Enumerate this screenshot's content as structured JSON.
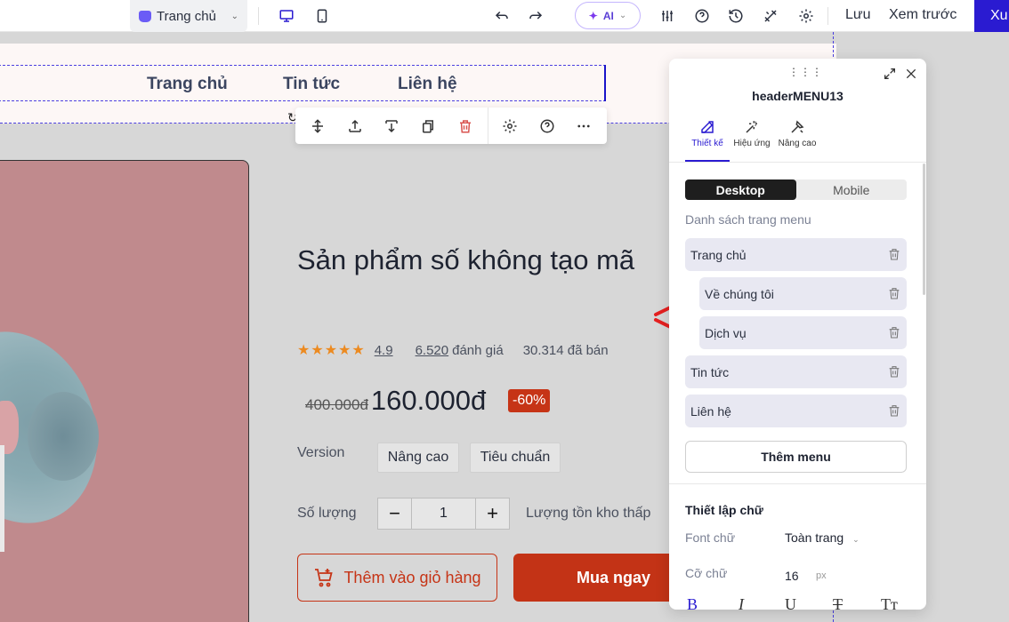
{
  "topbar": {
    "page_selector": "Trang chủ",
    "ai_label": "AI",
    "save_label": "Lưu",
    "preview_label": "Xem trước",
    "publish_label": "Xu"
  },
  "header_menu": {
    "links": [
      "Trang chủ",
      "Tin tức",
      "Liên hệ"
    ]
  },
  "product": {
    "title": "Sản phẩm số không tạo mã",
    "stars": "★★★★★",
    "rating": "4.9",
    "review_count": "6.520",
    "review_suffix": "đánh giá",
    "sold": "30.314 đã bán",
    "old_price": "400.000đ",
    "new_price": "160.000đ",
    "discount": "-60%",
    "version_label": "Version",
    "versions": [
      "Nâng cao",
      "Tiêu chuẩn"
    ],
    "quantity_label": "Số lượng",
    "quantity": "1",
    "minus": "−",
    "plus": "+",
    "stock_label": "Lượng tồn kho thấp",
    "add_to_cart": "Thêm vào giỏ hàng",
    "buy_now": "Mua ngay"
  },
  "panel": {
    "title": "headerMENU13",
    "tabs": [
      "Thiết kế",
      "Hiệu ứng",
      "Nâng cao"
    ],
    "segments": [
      "Desktop",
      "Mobile"
    ],
    "menu_list_label": "Danh sách trang menu",
    "menu_items": [
      "Trang chủ",
      "Về chúng tôi",
      "Dịch vụ",
      "Tin tức",
      "Liên hệ"
    ],
    "add_menu": "Thêm menu",
    "text_settings": "Thiết lập chữ",
    "font_label": "Font chữ",
    "font_value": "Toàn trang",
    "size_label": "Cỡ chữ",
    "size_value": "16",
    "size_unit": "px",
    "format_buttons": [
      "B",
      "I",
      "U",
      "T",
      "Tт"
    ]
  },
  "colors": {
    "accent": "#2a1bd1",
    "brand_red": "#c33316",
    "star": "#ec8a20"
  }
}
